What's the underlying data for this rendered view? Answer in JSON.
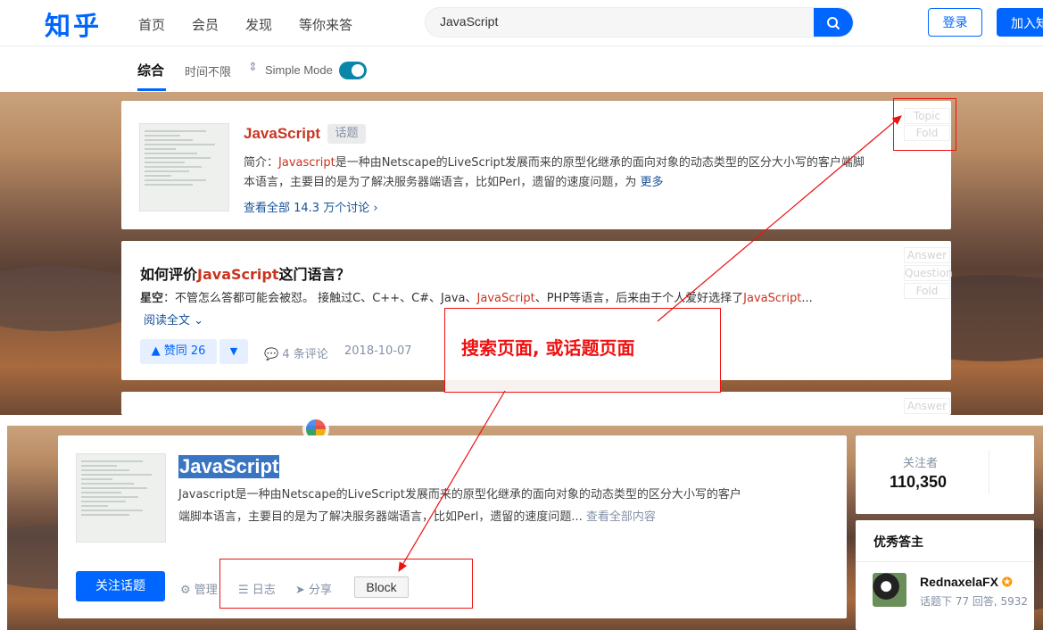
{
  "header": {
    "logo": "知乎",
    "nav": [
      "首页",
      "会员",
      "发现",
      "等你来答"
    ],
    "search_value": "JavaScript",
    "login_label": "登录",
    "join_label": "加入知乎"
  },
  "filters": {
    "tab_all": "综合",
    "time_filter": "时间不限",
    "simple_mode_label": "Simple Mode",
    "simple_mode_on": true
  },
  "topic_card": {
    "title": "JavaScript",
    "badge": "话题",
    "intro_prefix": "简介：",
    "intro_highlight": "Javascript",
    "intro_rest_line1": "是一种由Netscape的LiveScript发展而来的原型化继承的面向对象的动态类型的区分大小写的客户端脚",
    "intro_line2": "本语言，主要目的是为了解决服务器端语言，比如Perl，遗留的速度问题，为",
    "more_label": "更多",
    "discussion_link": "查看全部 14.3 万个讨论 ›",
    "ghost_topic": "Topic",
    "ghost_fold": "Fold"
  },
  "answer_card": {
    "title_prefix": "如何评价",
    "title_highlight": "JavaScript",
    "title_suffix": "这门语言？",
    "author": "星空",
    "excerpt_1": "：不管怎么答都可能会被怼。 接触过C、C++、C#、Java、",
    "excerpt_hl_1": "JavaScript",
    "excerpt_2": "、PHP等语言，后来由于个人爱好选择了",
    "excerpt_hl_2": "JavaScript",
    "excerpt_3": "...",
    "read_more": "阅读全文",
    "vote_label": "▲ 赞同 26",
    "comments": "4 条评论",
    "date": "2018-10-07",
    "ghost_answer": "Answer",
    "ghost_question": "Question",
    "ghost_fold": "Fold"
  },
  "third_card": {
    "ghost_answer": "Answer"
  },
  "annotation": {
    "text": "搜索页面, 或话题页面"
  },
  "topic_page": {
    "title": "JavaScript",
    "desc_line1": "Javascript是一种由Netscape的LiveScript发展而来的原型化继承的面向对象的动态类型的区分大小写的客户",
    "desc_line2": "端脚本语言，主要目的是为了解决服务器端语言，比如Perl，遗留的速度问题...",
    "view_all": "查看全部内容",
    "follow_label": "关注话题",
    "manage_label": "管理",
    "log_label": "日志",
    "share_label": "分享",
    "block_label": "Block"
  },
  "sidebar": {
    "followers_label": "关注者",
    "followers_count": "110,350",
    "best_answerers_title": "优秀答主",
    "user_name": "RednaxelaFX",
    "user_stats": "话题下 77 回答, 5932"
  },
  "colors": {
    "brand": "#0066ff",
    "highlight": "#c8341f",
    "annotation_red": "#e11111"
  }
}
